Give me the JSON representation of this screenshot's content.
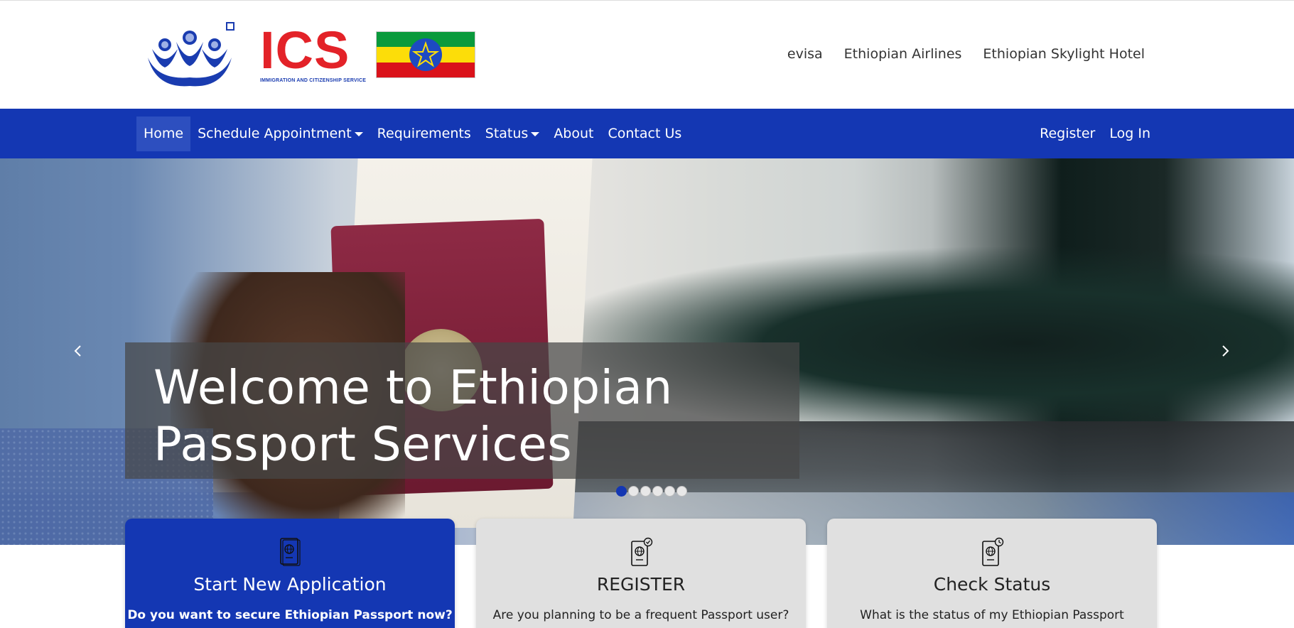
{
  "brand": {
    "logo_name": "ICS",
    "logo_subtitle": "IMMIGRATION AND CITIZENSHIP SERVICE",
    "accent_color": "#1437b3",
    "logo_red": "#e32228",
    "flag_colors": [
      "#0a9a3c",
      "#fcdd09",
      "#da121a"
    ]
  },
  "top_links": [
    {
      "label": "evisa"
    },
    {
      "label": "Ethiopian Airlines"
    },
    {
      "label": "Ethiopian Skylight Hotel"
    }
  ],
  "nav": {
    "left": [
      {
        "label": "Home",
        "active": true,
        "dropdown": false
      },
      {
        "label": "Schedule Appointment",
        "active": false,
        "dropdown": true
      },
      {
        "label": "Requirements",
        "active": false,
        "dropdown": false
      },
      {
        "label": "Status",
        "active": false,
        "dropdown": true
      },
      {
        "label": "About",
        "active": false,
        "dropdown": false
      },
      {
        "label": "Contact Us",
        "active": false,
        "dropdown": false
      }
    ],
    "right": [
      {
        "label": "Register"
      },
      {
        "label": "Log In"
      }
    ]
  },
  "hero": {
    "caption": "Welcome to Ethiopian Passport Services",
    "slide_count": 6,
    "active_slide": 1,
    "prev_icon": "chevron-left-icon",
    "next_icon": "chevron-right-icon"
  },
  "cards": [
    {
      "title": "Start New Application",
      "text": "Do you want to secure Ethiopian Passport now?",
      "icon": "passport-icon",
      "style": "primary"
    },
    {
      "title": "REGISTER",
      "text": "Are you planning to be a frequent Passport user?",
      "icon": "passport-check-icon",
      "style": "secondary"
    },
    {
      "title": "Check Status",
      "text": "What is the status of my Ethiopian Passport",
      "icon": "passport-clock-icon",
      "style": "secondary"
    }
  ]
}
